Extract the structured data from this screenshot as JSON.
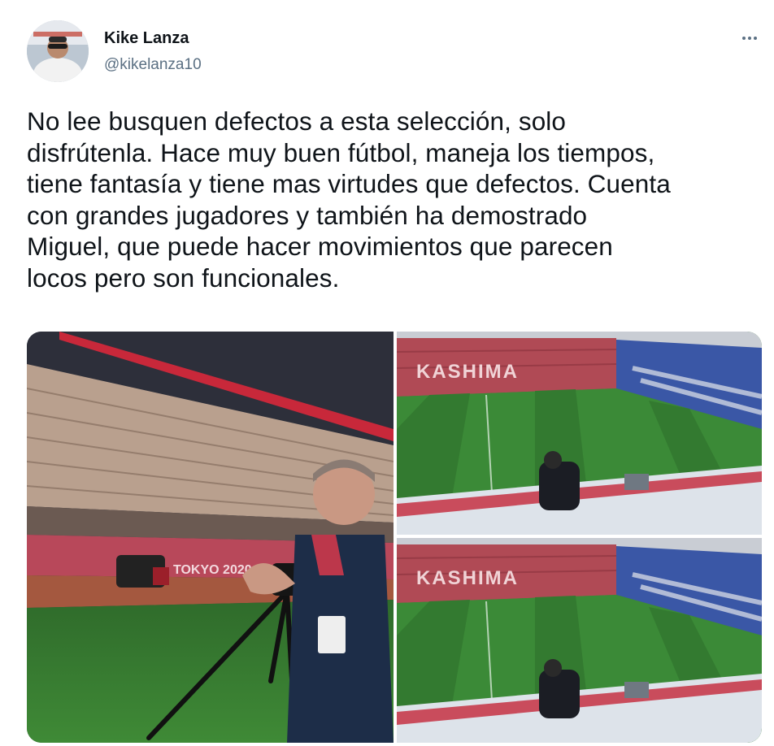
{
  "tweet": {
    "author": {
      "name": "Kike Lanza",
      "handle": "@kikelanza10"
    },
    "text_lines": [
      "No lee busquen defectos a esta selección, solo",
      "disfrútenla. Hace muy buen fútbol, maneja los tiempos,",
      "tiene fantasía y tiene mas virtudes que defectos. Cuenta",
      "con grandes jugadores y también ha demostrado",
      "Miguel, que puede hacer movimientos que parecen",
      "locos pero son funcionales."
    ],
    "media": {
      "photo1_board_text": "TOKYO 2020",
      "photo2_stand_text": "KASHIMA",
      "photo3_stand_text": "KASHIMA"
    },
    "more_icon": "more-horizontal-icon"
  }
}
